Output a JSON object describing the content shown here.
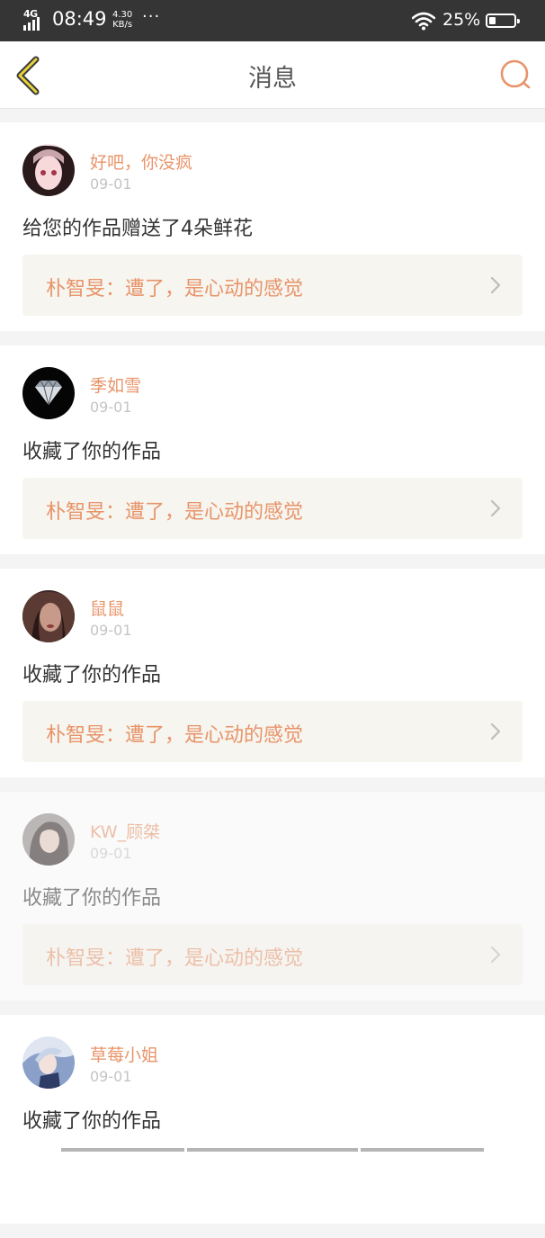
{
  "status_bar": {
    "network": "4G",
    "time": "08:49",
    "speed_value": "4.30",
    "speed_unit": "KB/s",
    "more": "···",
    "battery_percent": "25%"
  },
  "header": {
    "title": "消息",
    "back_icon": "back-chevron-icon",
    "search_icon": "search-icon",
    "accent_color": "#e8946a"
  },
  "messages": [
    {
      "username": "好吧，你没疯",
      "date": "09-01",
      "action": "给您的作品赠送了4朵鲜花",
      "work_title": "朴智旻：遭了，是心动的感觉"
    },
    {
      "username": "季如雪",
      "date": "09-01",
      "action": "收藏了你的作品",
      "work_title": "朴智旻：遭了，是心动的感觉"
    },
    {
      "username": "鼠鼠",
      "date": "09-01",
      "action": "收藏了你的作品",
      "work_title": "朴智旻：遭了，是心动的感觉"
    },
    {
      "username": "KW_顾桀",
      "date": "09-01",
      "action": "收藏了你的作品",
      "work_title": "朴智旻：遭了，是心动的感觉"
    },
    {
      "username": "草莓小姐",
      "date": "09-01",
      "action": "收藏了你的作品",
      "work_title": ""
    }
  ]
}
